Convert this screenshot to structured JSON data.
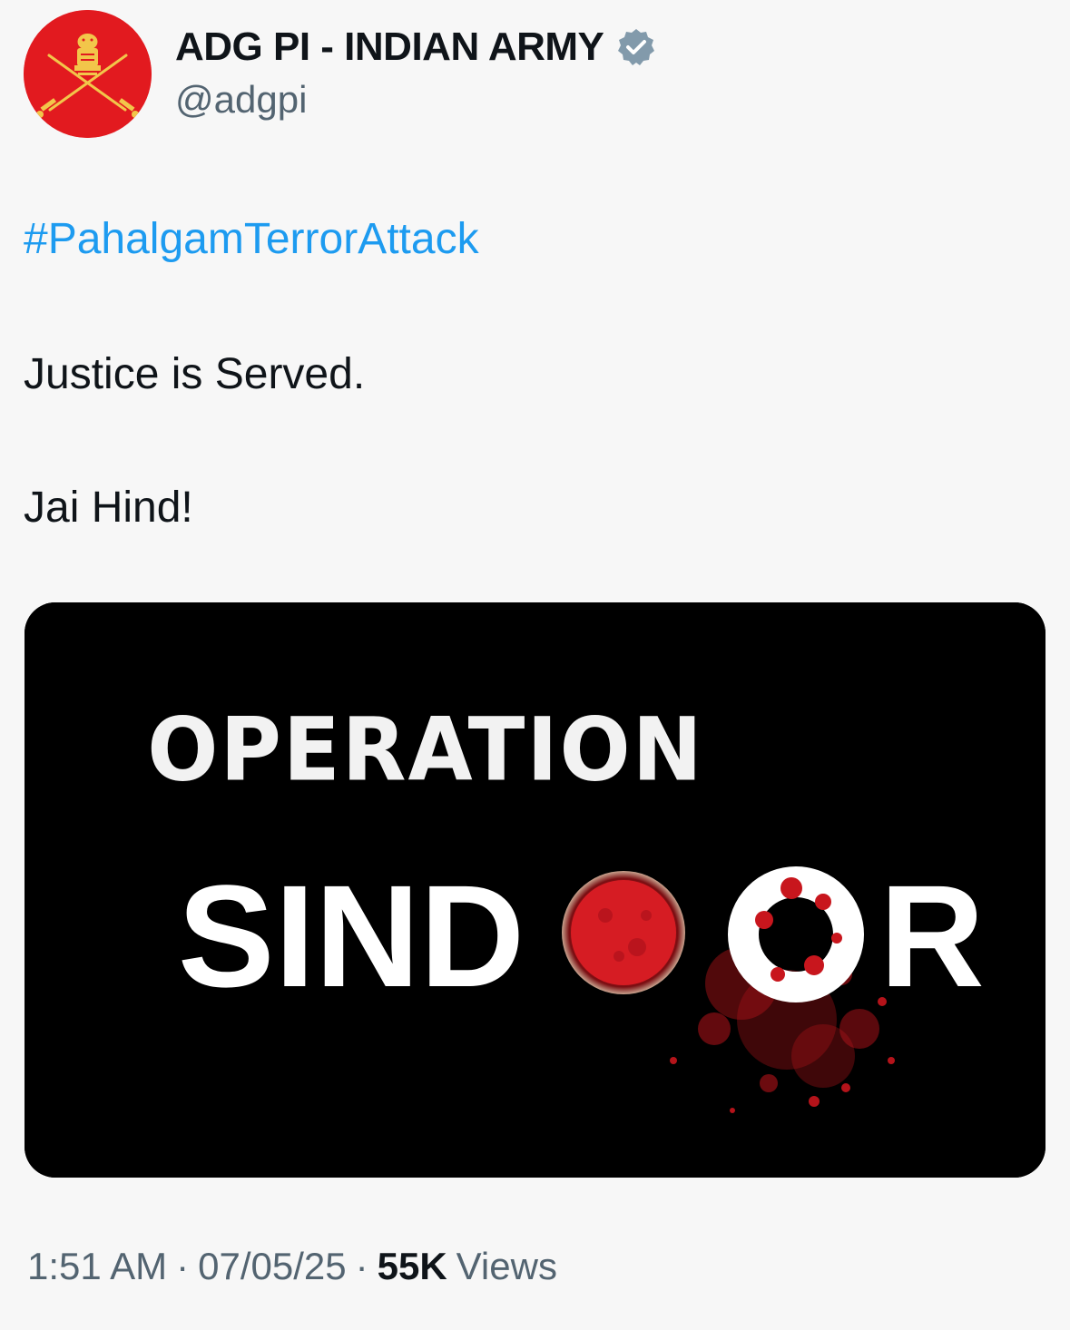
{
  "author": {
    "display_name": "ADG PI - INDIAN ARMY",
    "handle": "@adgpi",
    "verified": true,
    "verified_badge_color": "#829aab",
    "avatar_color": "#e21a1f",
    "avatar_icon": "indian-army-emblem"
  },
  "tweet": {
    "hashtag": "#PahalgamTerrorAttack",
    "line1": "Justice is Served.",
    "line2": "Jai Hind!",
    "link_color": "#1d9bf0"
  },
  "media": {
    "title_top": "OPERATION",
    "title_bottom_start": "SIND",
    "title_bottom_end": "R",
    "accent_color": "#c8161d"
  },
  "meta": {
    "time": "1:51 AM",
    "date": "07/05/25",
    "separator": "·",
    "views_count": "55K",
    "views_label": "Views"
  }
}
